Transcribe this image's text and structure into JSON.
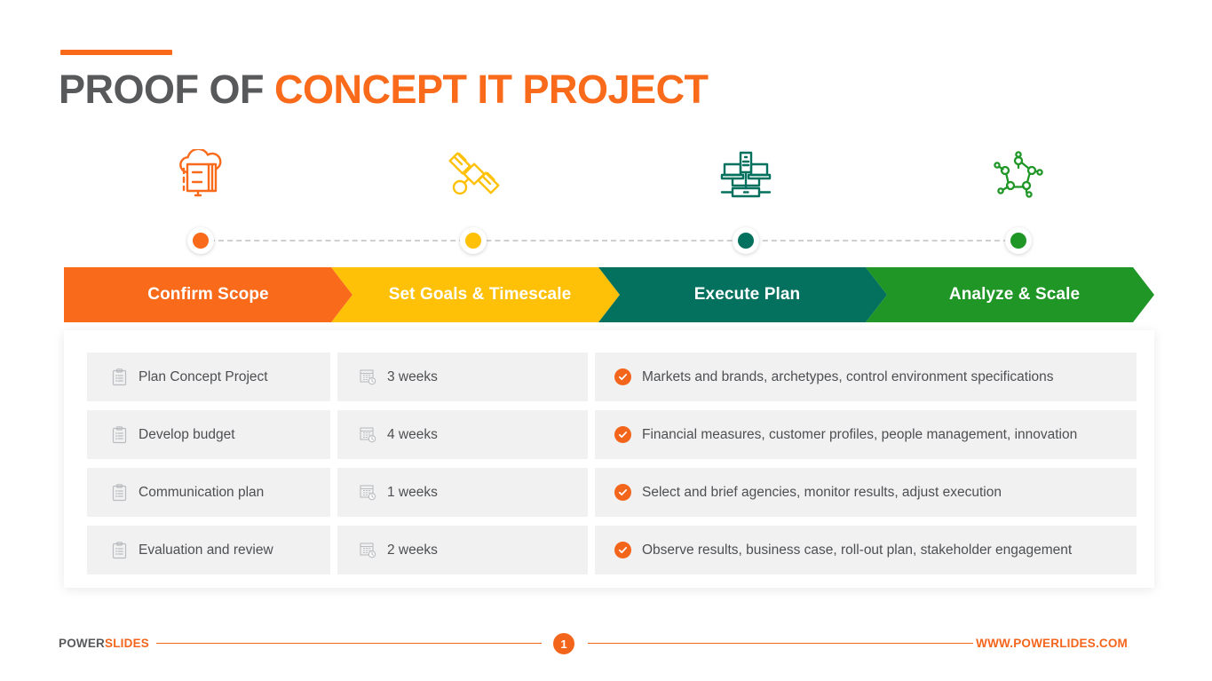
{
  "slide": {
    "title_part1": "PROOF OF ",
    "title_part2": "CONCEPT IT PROJECT",
    "accent_color": "#f96a1b"
  },
  "stages": [
    {
      "label": "Confirm Scope",
      "color": "#f96a1b",
      "dot_color": "#f96a1b",
      "icon": "cloud-server-icon",
      "icon_color": "#f96a1b"
    },
    {
      "label": "Set Goals & Timescale",
      "color": "#ffc107",
      "dot_color": "#ffc107",
      "icon": "satellite-icon",
      "icon_color": "#ffc107"
    },
    {
      "label": "Execute Plan",
      "color": "#04705e",
      "dot_color": "#04705e",
      "icon": "network-servers-icon",
      "icon_color": "#04705e"
    },
    {
      "label": "Analyze & Scale",
      "color": "#1f9626",
      "dot_color": "#1f9626",
      "icon": "node-graph-icon",
      "icon_color": "#1f9626"
    }
  ],
  "table": {
    "task_icon": "clipboard-icon",
    "time_icon": "calendar-clock-icon",
    "desc_icon": "check-circle-icon",
    "check_color": "#f4651c",
    "rows": [
      {
        "task": "Plan Concept Project",
        "time": "3 weeks",
        "description": "Markets and brands, archetypes, control environment specifications"
      },
      {
        "task": "Develop budget",
        "time": "4 weeks",
        "description": "Financial measures, customer profiles, people management, innovation"
      },
      {
        "task": "Communication plan",
        "time": "1 weeks",
        "description": "Select and brief agencies, monitor results, adjust execution"
      },
      {
        "task": "Evaluation and review",
        "time": "2 weeks",
        "description": "Observe results, business case, roll-out plan, stakeholder engagement"
      }
    ]
  },
  "footer": {
    "brand_part1": "POWER",
    "brand_part2": "SLIDES",
    "page_number": "1",
    "website": "WWW.POWERLIDES.COM",
    "line_color": "#f4651c"
  }
}
